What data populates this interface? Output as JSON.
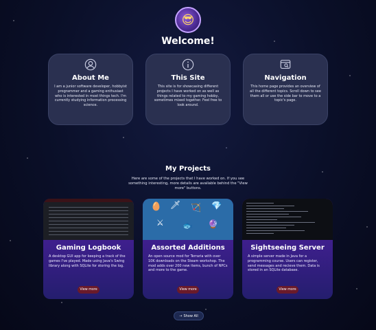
{
  "header": {
    "avatar_icon": "cat-with-sunglasses-avatar",
    "welcome": "Welcome!"
  },
  "cards": [
    {
      "icon": "user-circle-icon",
      "title": "About Me",
      "text": "I am a junior software developer, hobbyist programmer and a gaming enthusiast who is interested in most things tech. I'm currently studying information processing science."
    },
    {
      "icon": "info-circle-icon",
      "title": "This Site",
      "text": "This site is for showcasing different projects I have worked on as well as things related to my gaming hobby, sometimes mixed together. Feel free to look around."
    },
    {
      "icon": "window-search-icon",
      "title": "Navigation",
      "text": "This home page provides an overview of all the different topics. Scroll down to see them all or use the side bar to move to a topic's page."
    }
  ],
  "projects_section": {
    "title": "My Projects",
    "description": "Here are some of the projects that I have worked on. If you see something interesting, more details are available behind the \"View more\" buttons."
  },
  "projects": [
    {
      "title": "Gaming Logbook",
      "text": "A desktop GUI app for keeping a track of the games I've played. Made using Java's Swing library along with SQLite for storing the log.",
      "button": "View more"
    },
    {
      "title": "Assorted Additions",
      "text": "An open source mod for Terraria with over 10K downloads on the Steam workshop. The mod adds over 200 new items, bunch of NPCs and more to the game.",
      "button": "View more"
    },
    {
      "title": "Sightseeing Server",
      "text": "A simple server made in Java for a programming course. Users can register, send messages and recieve them. Data is stored in an SQLite database.",
      "button": "View more"
    }
  ],
  "show_all": {
    "label": "Show All",
    "icon": "arrow-right-icon"
  }
}
